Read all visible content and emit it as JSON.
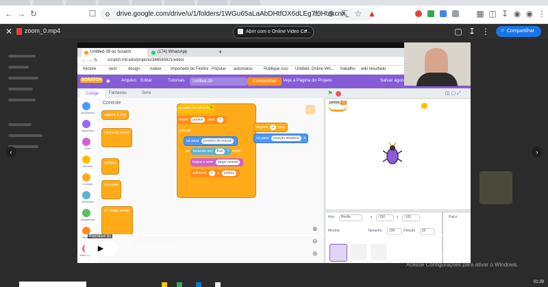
{
  "browser": {
    "url": "drive.google.com/drive/u/1/folders/1WGu65aLaAbDHtfOX6dLEg7f0Htzkcnx_"
  },
  "viewer": {
    "file_name": "zoom_0.mp4",
    "open_with": "Abrir com o Online Video Co...",
    "share": "Compartilhar"
  },
  "inner_browser": {
    "tabs": [
      "Untitled-39 on Scratch",
      "(174) WhatsApp"
    ],
    "url": "scratch.mit.edu/projects/386565921/editor",
    "bookmarks": [
      "folclore",
      "tech",
      "design",
      "maker",
      "Importado do Firefox",
      "Popular",
      "automatos",
      "Publique isso",
      "Untitled. Online Wh...",
      "trabalho",
      "wiki resultado"
    ]
  },
  "scratch": {
    "logo": "SCRATCH",
    "menu": [
      "Arquivo",
      "Editar",
      "Tutoriais",
      "Untitled-39",
      "Compartilhar",
      "Veja a Página do Projeto",
      "Salvar agora"
    ],
    "tabs": [
      "Código",
      "Fantasias",
      "Sons"
    ],
    "categories": [
      {
        "label": "Movimento",
        "color": "#4c97ff"
      },
      {
        "label": "Aparência",
        "color": "#9966ff"
      },
      {
        "label": "Som",
        "color": "#cf63cf"
      },
      {
        "label": "Eventos",
        "color": "#ffbf00"
      },
      {
        "label": "Controle",
        "color": "#ffab19"
      },
      {
        "label": "Sensores",
        "color": "#5cb1d6"
      },
      {
        "label": "Operadores",
        "color": "#59c059"
      },
      {
        "label": "Variáveis",
        "color": "#ff8c1a"
      },
      {
        "label": "Meus Blocos",
        "color": "#ff6680"
      }
    ],
    "palette_title": "Controle",
    "palette_blocks": [
      "espere 1 seg",
      "repita 10 vezes",
      "sempre",
      "se então",
      "se então senão"
    ],
    "script": {
      "hat": "quando  for clicado",
      "set_var": "mude",
      "var_name": "pontos",
      "to": "para",
      "var_value": "0",
      "forever": "sempre",
      "goto": "vá para",
      "goto_target": "ponteiro do mouse",
      "if": "se",
      "touching": "tocando em",
      "touching_target": "Ball",
      "then": "então",
      "play_sound": "toque o som",
      "sound": "pegar moeda",
      "add": "adicione",
      "add_value": "1",
      "add_to": "a",
      "add_var": "pontos"
    },
    "script2": {
      "wait": "espere",
      "wait_value": "1",
      "wait_unit": "seg",
      "goto": "vá para",
      "goto_target": "posição aleatória"
    },
    "stage_monitor": {
      "label": "pontos",
      "value": "0"
    },
    "sprite_info": {
      "sprite_label": "Ator",
      "sprite_name": "Beetle",
      "x_label": "x",
      "x": "-150",
      "y_label": "y",
      "y": "-165",
      "show_label": "Mostrar",
      "size_label": "Tamanho",
      "size": "100",
      "dir_label": "Direção",
      "dir": "90"
    },
    "stage_label": "Palco"
  },
  "player": {
    "tooltip": "Reproduzir (k)",
    "time": "10:48 / 17:16",
    "progress": 0.625,
    "speed": "1X"
  },
  "watermark": {
    "title": "Ativar o Windows",
    "subtitle": "Acesse Configurações para ativar o Windows."
  },
  "taskbar": {
    "clock": "01:29"
  }
}
